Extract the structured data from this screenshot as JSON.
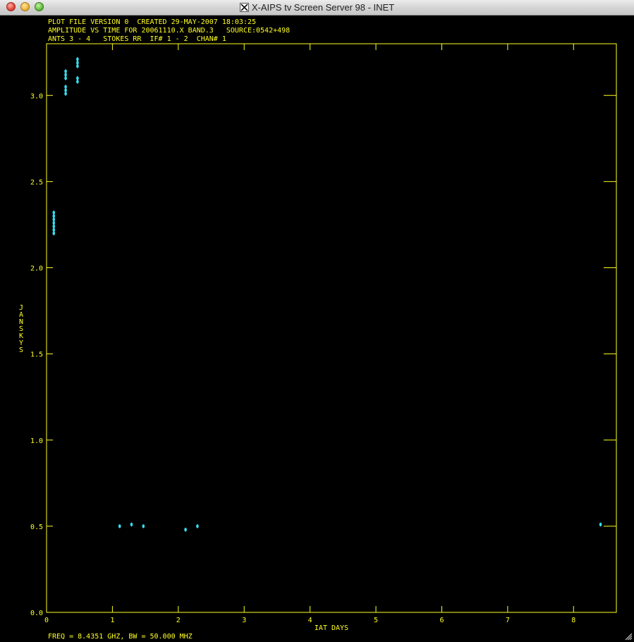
{
  "window": {
    "title": "X-AIPS tv Screen Server 98 - INET",
    "title_icon": "x11-icon"
  },
  "header": {
    "line1": "PLOT FILE VERSION 0  CREATED 29-MAY-2007 18:03:25",
    "line2": "AMPLITUDE VS TIME FOR 20061110.X BAND.3   SOURCE:0542+498",
    "line3": "ANTS 3 - 4   STOKES RR  IF# 1 - 2  CHAN# 1"
  },
  "footer": {
    "freq": "FREQ = 8.4351 GHZ, BW = 50.000 MHZ"
  },
  "colors": {
    "background": "#000000",
    "axes": "#ffff22",
    "points": "#33ddee"
  },
  "chart_data": {
    "type": "scatter",
    "title": "",
    "xlabel": "IAT DAYS",
    "ylabel": "JANSKYS",
    "xlim": [
      0,
      8.65
    ],
    "ylim": [
      0,
      3.3
    ],
    "x_ticks": [
      "0",
      "1",
      "2",
      "3",
      "4",
      "5",
      "6",
      "7",
      "8"
    ],
    "y_ticks": [
      "0.0",
      "0.5",
      "1.0",
      "1.5",
      "2.0",
      "2.5",
      "3.0"
    ],
    "grid": false,
    "series": [
      {
        "points": [
          {
            "x": 0.11,
            "y": 2.2
          },
          {
            "x": 0.11,
            "y": 2.22
          },
          {
            "x": 0.11,
            "y": 2.24
          },
          {
            "x": 0.11,
            "y": 2.26
          },
          {
            "x": 0.11,
            "y": 2.28
          },
          {
            "x": 0.11,
            "y": 2.3
          },
          {
            "x": 0.11,
            "y": 2.32
          },
          {
            "x": 0.29,
            "y": 3.01
          },
          {
            "x": 0.29,
            "y": 3.03
          },
          {
            "x": 0.29,
            "y": 3.05
          },
          {
            "x": 0.29,
            "y": 3.1
          },
          {
            "x": 0.29,
            "y": 3.12
          },
          {
            "x": 0.29,
            "y": 3.14
          },
          {
            "x": 0.47,
            "y": 3.08
          },
          {
            "x": 0.47,
            "y": 3.1
          },
          {
            "x": 0.47,
            "y": 3.17
          },
          {
            "x": 0.47,
            "y": 3.19
          },
          {
            "x": 0.47,
            "y": 3.21
          },
          {
            "x": 1.11,
            "y": 0.5
          },
          {
            "x": 1.29,
            "y": 0.51
          },
          {
            "x": 1.47,
            "y": 0.5
          },
          {
            "x": 2.11,
            "y": 0.48
          },
          {
            "x": 2.29,
            "y": 0.5
          },
          {
            "x": 8.41,
            "y": 0.51
          }
        ]
      }
    ]
  }
}
